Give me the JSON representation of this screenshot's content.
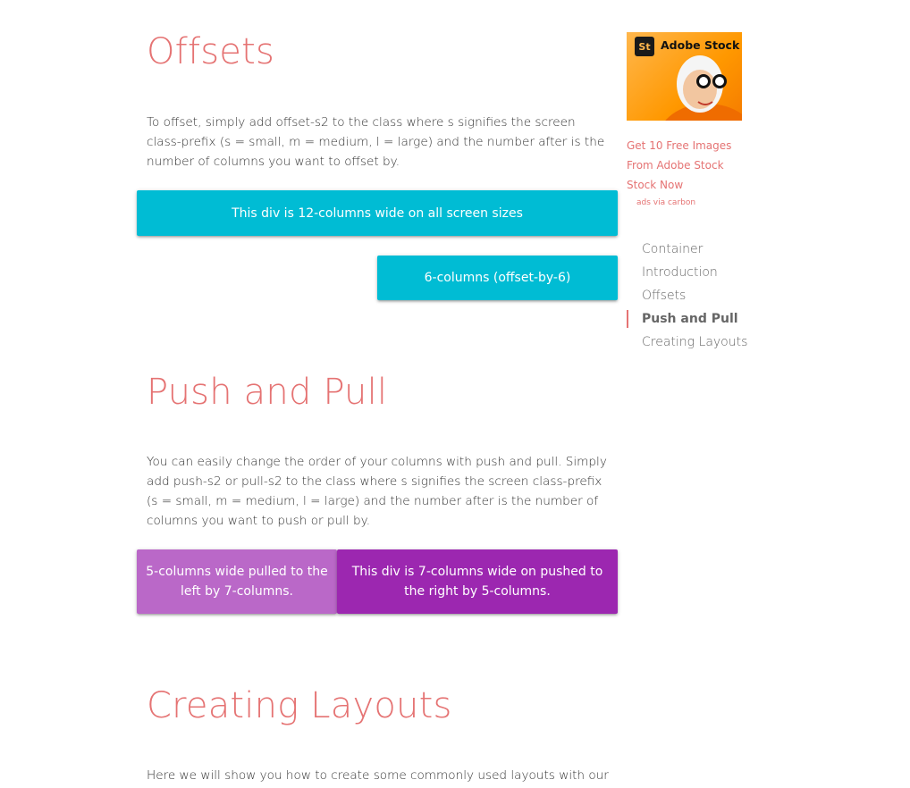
{
  "sections": {
    "offsets": {
      "title": "Offsets",
      "description": "To offset, simply add offset-s2 to the class where s signifies the screen class-prefix (s = small, m = medium, l = large) and the number after is the number of columns you want to offset by.",
      "demo_full": "This div is 12-columns wide on all screen sizes",
      "demo_offset": "6-columns (offset-by-6)"
    },
    "push_pull": {
      "title": "Push and Pull",
      "description": "You can easily change the order of your columns with push and pull. Simply add push-s2 or pull-s2 to the class where s signifies the screen class-prefix (s = small, m = medium, l = large) and the number after is the number of columns you want to push or pull by.",
      "demo_pulled": "5-columns wide pulled to the left by 7-columns.",
      "demo_pushed": "This div is 7-columns wide on pushed to the right by 5-columns."
    },
    "layouts": {
      "title": "Creating Layouts",
      "description": "Here we will show you how to create some commonly used layouts with our grid"
    }
  },
  "ad": {
    "logo_text": "St",
    "brand": "Adobe Stock",
    "text": "Get 10 Free Images From Adobe Stock Stock Now",
    "via": "ads via carbon"
  },
  "toc": {
    "items": [
      {
        "label": "Container",
        "active": false
      },
      {
        "label": "Introduction",
        "active": false
      },
      {
        "label": "Offsets",
        "active": false
      },
      {
        "label": "Push and Pull",
        "active": true
      },
      {
        "label": "Creating Layouts",
        "active": false
      }
    ]
  },
  "colors": {
    "heading": "#e57373",
    "teal": "#00bcd4",
    "purple_light": "#ba68c8",
    "purple": "#9c27b0"
  }
}
